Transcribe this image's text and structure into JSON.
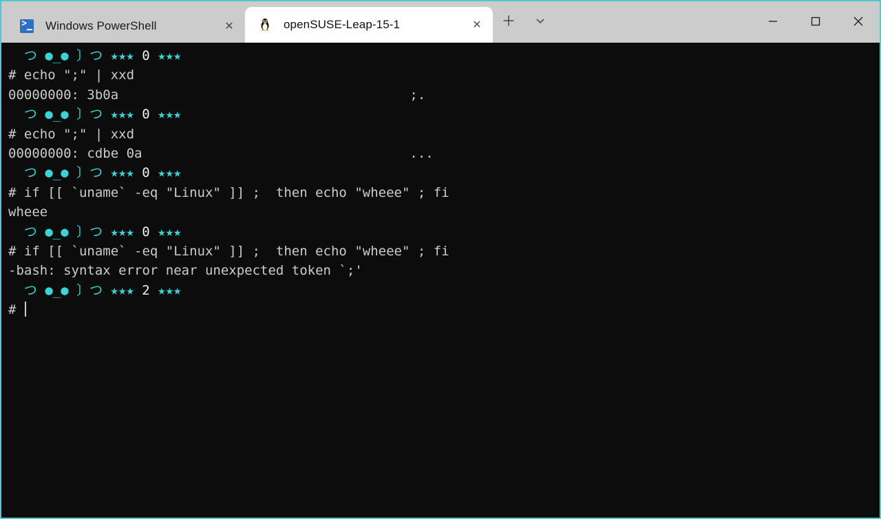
{
  "window": {
    "accent_color": "#4ec9cd",
    "titlebar_bg": "#cccccc",
    "terminal_bg": "#0c0c0c",
    "terminal_fg": "#cccccc",
    "prompt_color": "#3ad4d4"
  },
  "tabs": [
    {
      "label": "Windows PowerShell",
      "icon": "powershell-icon",
      "active": false,
      "close_label": "✕"
    },
    {
      "label": "openSUSE-Leap-15-1",
      "icon": "tux-penguin-icon",
      "active": true,
      "close_label": "✕"
    }
  ],
  "tabbar": {
    "new_tab_label": "+",
    "dropdown_label": "⌄"
  },
  "window_controls": {
    "minimize": "─",
    "maximize": "□",
    "close": "✕"
  },
  "terminal": {
    "prompt_face": "  つ ●_● 〕つ ",
    "prompt_stars_left": "★★★",
    "prompt_stars_right": "★★★",
    "lines": [
      {
        "type": "prompt",
        "exit_code": "0"
      },
      {
        "type": "command",
        "text": "# echo \";\" | xxd"
      },
      {
        "type": "output",
        "text": "00000000: 3b0a                                     ;."
      },
      {
        "type": "prompt",
        "exit_code": "0"
      },
      {
        "type": "command",
        "text": "# echo \";\" | xxd"
      },
      {
        "type": "output",
        "text": "00000000: cdbe 0a                                  ..."
      },
      {
        "type": "prompt",
        "exit_code": "0"
      },
      {
        "type": "command",
        "text": "# if [[ `uname` -eq \"Linux\" ]] ;  then echo \"wheee\" ; fi"
      },
      {
        "type": "output",
        "text": "wheee"
      },
      {
        "type": "prompt",
        "exit_code": "0"
      },
      {
        "type": "command",
        "text": "# if [[ `uname` -eq \"Linux\" ]] ;  then echo \"wheee\" ; fi"
      },
      {
        "type": "output",
        "text": "-bash: syntax error near unexpected token `;'"
      },
      {
        "type": "prompt",
        "exit_code": "2"
      },
      {
        "type": "cursor_line",
        "text": "# "
      }
    ]
  }
}
